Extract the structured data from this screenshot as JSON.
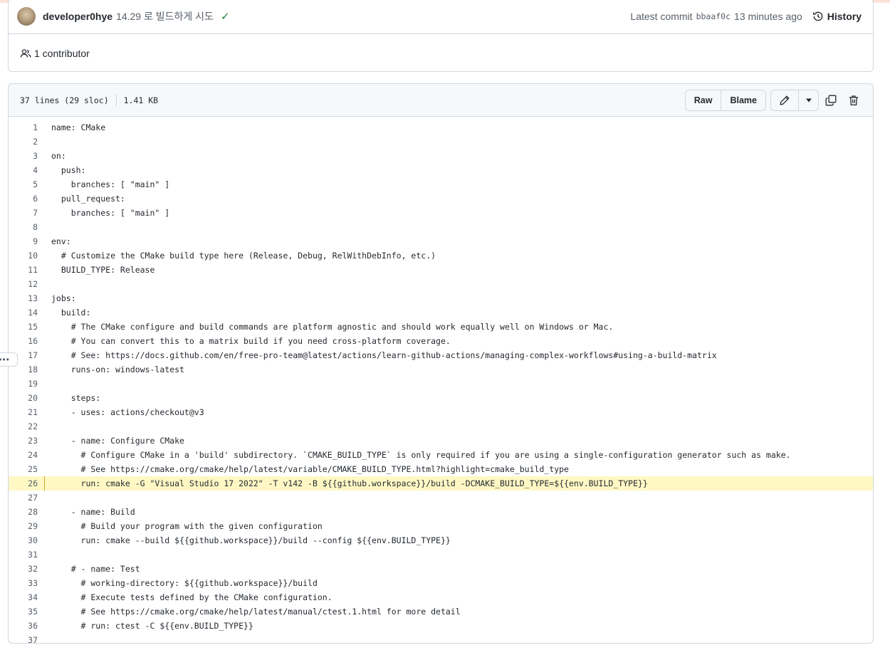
{
  "commit": {
    "author": "developer0hye",
    "message": "14.29 로 빌드하게 시도",
    "latest_label": "Latest commit",
    "sha": "bbaaf0c",
    "time": "13 minutes ago",
    "history_label": "History",
    "contributors": "1 contributor"
  },
  "file": {
    "lines_info": "37 lines (29 sloc)",
    "size": "1.41 KB",
    "raw_label": "Raw",
    "blame_label": "Blame"
  },
  "code_lines": [
    {
      "n": "1",
      "t": "name: CMake"
    },
    {
      "n": "2",
      "t": ""
    },
    {
      "n": "3",
      "t": "on:"
    },
    {
      "n": "4",
      "t": "  push:"
    },
    {
      "n": "5",
      "t": "    branches: [ \"main\" ]"
    },
    {
      "n": "6",
      "t": "  pull_request:"
    },
    {
      "n": "7",
      "t": "    branches: [ \"main\" ]"
    },
    {
      "n": "8",
      "t": ""
    },
    {
      "n": "9",
      "t": "env:"
    },
    {
      "n": "10",
      "t": "  # Customize the CMake build type here (Release, Debug, RelWithDebInfo, etc.)"
    },
    {
      "n": "11",
      "t": "  BUILD_TYPE: Release"
    },
    {
      "n": "12",
      "t": ""
    },
    {
      "n": "13",
      "t": "jobs:"
    },
    {
      "n": "14",
      "t": "  build:"
    },
    {
      "n": "15",
      "t": "    # The CMake configure and build commands are platform agnostic and should work equally well on Windows or Mac."
    },
    {
      "n": "16",
      "t": "    # You can convert this to a matrix build if you need cross-platform coverage."
    },
    {
      "n": "17",
      "t": "    # See: https://docs.github.com/en/free-pro-team@latest/actions/learn-github-actions/managing-complex-workflows#using-a-build-matrix"
    },
    {
      "n": "18",
      "t": "    runs-on: windows-latest"
    },
    {
      "n": "19",
      "t": ""
    },
    {
      "n": "20",
      "t": "    steps:"
    },
    {
      "n": "21",
      "t": "    - uses: actions/checkout@v3"
    },
    {
      "n": "22",
      "t": ""
    },
    {
      "n": "23",
      "t": "    - name: Configure CMake"
    },
    {
      "n": "24",
      "t": "      # Configure CMake in a 'build' subdirectory. `CMAKE_BUILD_TYPE` is only required if you are using a single-configuration generator such as make."
    },
    {
      "n": "25",
      "t": "      # See https://cmake.org/cmake/help/latest/variable/CMAKE_BUILD_TYPE.html?highlight=cmake_build_type"
    },
    {
      "n": "26",
      "t": "      run: cmake -G \"Visual Studio 17 2022\" -T v142 -B ${{github.workspace}}/build -DCMAKE_BUILD_TYPE=${{env.BUILD_TYPE}}"
    },
    {
      "n": "27",
      "t": ""
    },
    {
      "n": "28",
      "t": "    - name: Build"
    },
    {
      "n": "29",
      "t": "      # Build your program with the given configuration"
    },
    {
      "n": "30",
      "t": "      run: cmake --build ${{github.workspace}}/build --config ${{env.BUILD_TYPE}}"
    },
    {
      "n": "31",
      "t": ""
    },
    {
      "n": "32",
      "t": "    # - name: Test"
    },
    {
      "n": "33",
      "t": "      # working-directory: ${{github.workspace}}/build"
    },
    {
      "n": "34",
      "t": "      # Execute tests defined by the CMake configuration."
    },
    {
      "n": "35",
      "t": "      # See https://cmake.org/cmake/help/latest/manual/ctest.1.html for more detail"
    },
    {
      "n": "36",
      "t": "      # run: ctest -C ${{env.BUILD_TYPE}}"
    },
    {
      "n": "37",
      "t": ""
    }
  ],
  "highlighted_line": "26",
  "colors": {
    "highlight_bg": "#fff8c5",
    "success": "#1a7f37",
    "border": "#d0d7de"
  }
}
